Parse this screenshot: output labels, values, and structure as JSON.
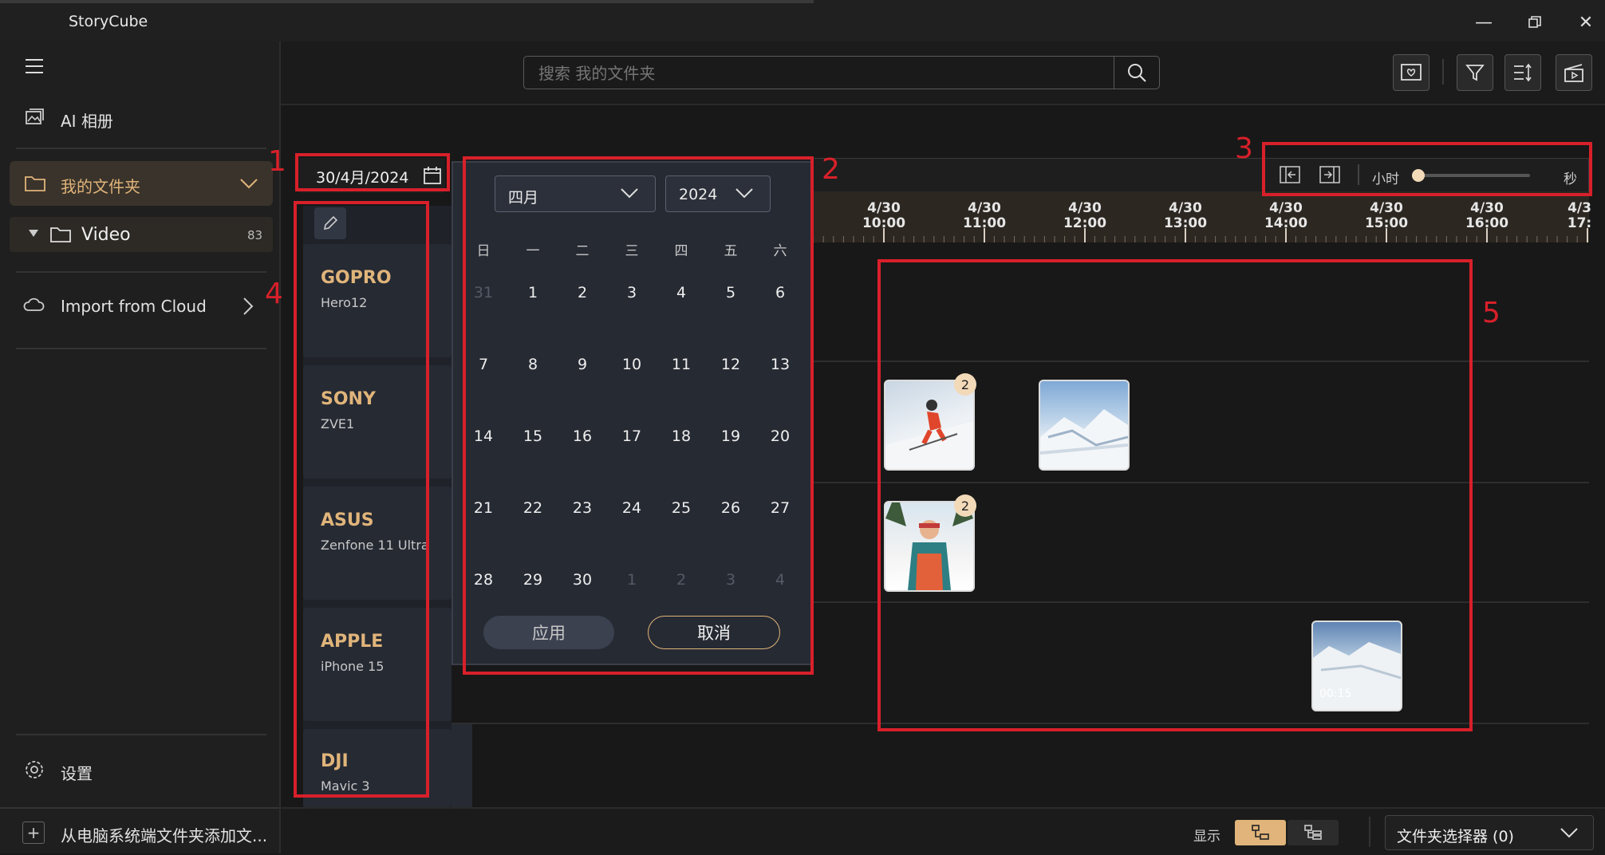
{
  "app": {
    "title": "StoryCube"
  },
  "sidebar": {
    "ai_album": "AI 相册",
    "my_folders": "我的文件夹",
    "video_folder": {
      "label": "Video",
      "count": "83"
    },
    "import_cloud": "Import from Cloud",
    "settings": "设置",
    "add_folder": "从电脑系统端文件夹添加文..."
  },
  "search": {
    "placeholder": "搜索 我的文件夹"
  },
  "date_picker": {
    "value": "30/4月/2024"
  },
  "calendar": {
    "month": "四月",
    "year": "2024",
    "weekdays": [
      "日",
      "一",
      "二",
      "三",
      "四",
      "五",
      "六"
    ],
    "weeks": [
      [
        "31",
        "1",
        "2",
        "3",
        "4",
        "5",
        "6"
      ],
      [
        "7",
        "8",
        "9",
        "10",
        "11",
        "12",
        "13"
      ],
      [
        "14",
        "15",
        "16",
        "17",
        "18",
        "19",
        "20"
      ],
      [
        "21",
        "22",
        "23",
        "24",
        "25",
        "26",
        "27"
      ],
      [
        "28",
        "29",
        "30",
        "1",
        "2",
        "3",
        "4"
      ]
    ],
    "apply": "应用",
    "cancel": "取消"
  },
  "zoom": {
    "min_label": "小时",
    "max_label": "秒",
    "level": 0.0
  },
  "timeline": {
    "ticks": [
      {
        "date": "4/30",
        "time": "10:00"
      },
      {
        "date": "4/30",
        "time": "11:00"
      },
      {
        "date": "4/30",
        "time": "12:00"
      },
      {
        "date": "4/30",
        "time": "13:00"
      },
      {
        "date": "4/30",
        "time": "14:00"
      },
      {
        "date": "4/30",
        "time": "15:00"
      },
      {
        "date": "4/30",
        "time": "16:00"
      },
      {
        "date": "4/3",
        "time": "17:"
      }
    ]
  },
  "devices": [
    {
      "brand": "GOPRO",
      "model": "Hero12"
    },
    {
      "brand": "SONY",
      "model": "ZVE1"
    },
    {
      "brand": "ASUS",
      "model": "Zenfone 11 Ultra"
    },
    {
      "brand": "APPLE",
      "model": "iPhone 15"
    },
    {
      "brand": "DJI",
      "model": "Mavic 3"
    }
  ],
  "media": {
    "sony_thumb1_badge": "2",
    "asus_thumb_badge": "2",
    "apple_video_duration": "00:15"
  },
  "annotations": [
    "1",
    "2",
    "3",
    "4",
    "5"
  ],
  "bottom": {
    "display_label": "显示",
    "folder_selector": "文件夹选择器 (0)"
  },
  "colors": {
    "accent": "#e0b47a",
    "annotation": "#d8202a",
    "panel": "#262a33"
  }
}
